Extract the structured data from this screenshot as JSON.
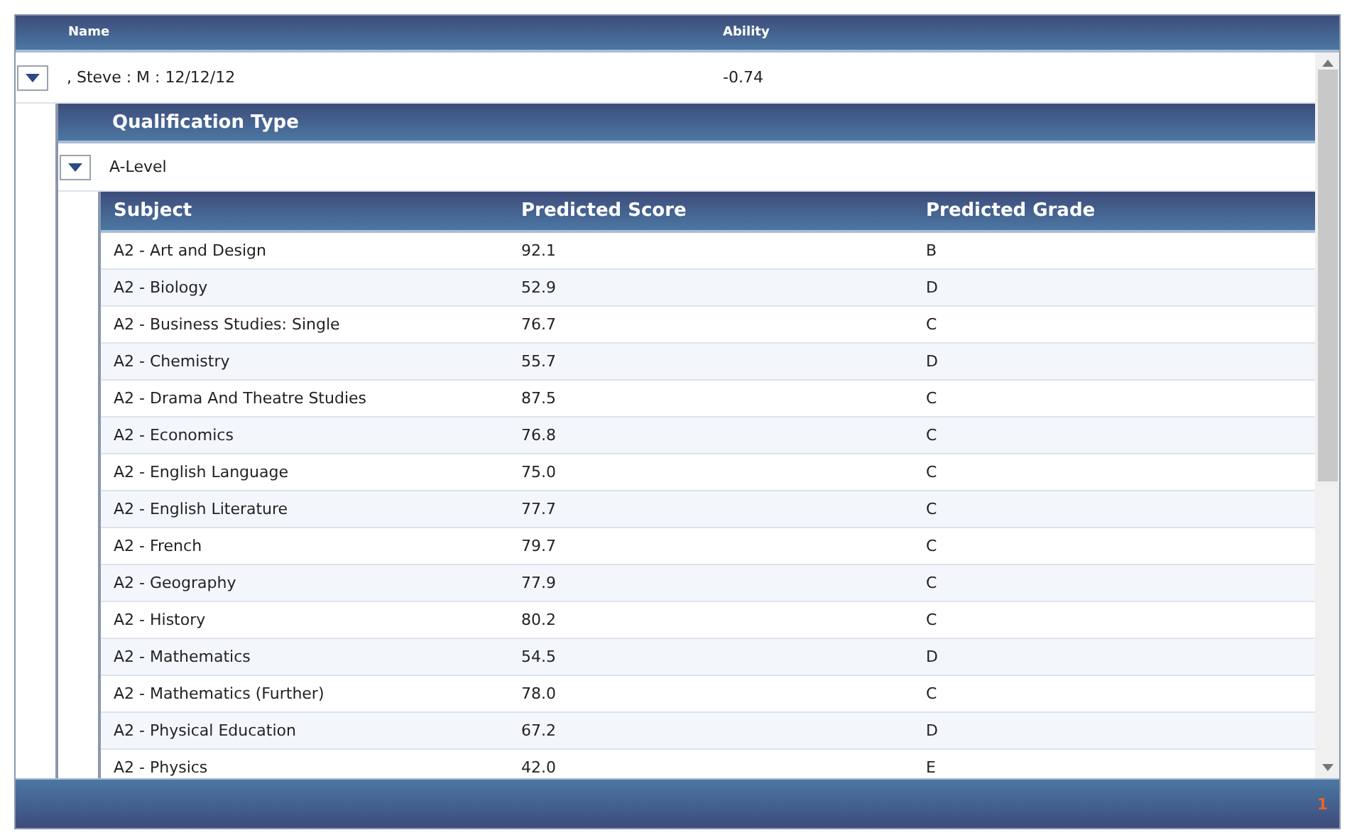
{
  "grid": {
    "columns": [
      {
        "label": "Name"
      },
      {
        "label": "Ability"
      }
    ],
    "row": {
      "expanded": true,
      "name": ", Steve : M : 12/12/12",
      "ability": "-0.74",
      "qualifications": {
        "columns": [
          {
            "label": "Qualification Type"
          }
        ],
        "row": {
          "expanded": true,
          "type": "A-Level",
          "subjects": {
            "columns": [
              {
                "label": "Subject"
              },
              {
                "label": "Predicted Score"
              },
              {
                "label": "Predicted Grade"
              }
            ],
            "rows": [
              {
                "subject": "A2 - Art and Design",
                "score": "92.1",
                "grade": "B"
              },
              {
                "subject": "A2 - Biology",
                "score": "52.9",
                "grade": "D"
              },
              {
                "subject": "A2 - Business Studies: Single",
                "score": "76.7",
                "grade": "C"
              },
              {
                "subject": "A2 - Chemistry",
                "score": "55.7",
                "grade": "D"
              },
              {
                "subject": "A2 - Drama And Theatre Studies",
                "score": "87.5",
                "grade": "C"
              },
              {
                "subject": "A2 - Economics",
                "score": "76.8",
                "grade": "C"
              },
              {
                "subject": "A2 - English Language",
                "score": "75.0",
                "grade": "C"
              },
              {
                "subject": "A2 - English Literature",
                "score": "77.7",
                "grade": "C"
              },
              {
                "subject": "A2 - French",
                "score": "79.7",
                "grade": "C"
              },
              {
                "subject": "A2 - Geography",
                "score": "77.9",
                "grade": "C"
              },
              {
                "subject": "A2 - History",
                "score": "80.2",
                "grade": "C"
              },
              {
                "subject": "A2 - Mathematics",
                "score": "54.5",
                "grade": "D"
              },
              {
                "subject": "A2 - Mathematics (Further)",
                "score": "78.0",
                "grade": "C"
              },
              {
                "subject": "A2 - Physical Education",
                "score": "67.2",
                "grade": "D"
              },
              {
                "subject": "A2 - Physics",
                "score": "42.0",
                "grade": "E"
              }
            ]
          }
        }
      }
    },
    "pager": {
      "page": "1"
    }
  }
}
